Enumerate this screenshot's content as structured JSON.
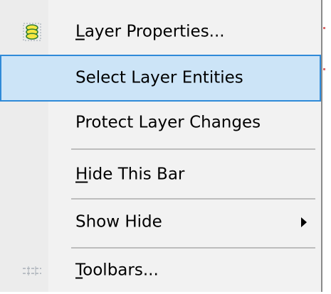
{
  "menu": {
    "items": [
      {
        "label_access": "L",
        "label_rest": "ayer Properties...",
        "icon": "layers-icon",
        "highlighted": false
      },
      {
        "label_access": "",
        "label_rest": "Select Layer Entities",
        "icon": "",
        "highlighted": true
      },
      {
        "label_access": "",
        "label_rest": "Protect Layer Changes",
        "icon": "",
        "highlighted": false
      },
      {
        "label_access": "H",
        "label_rest": "ide This Bar",
        "icon": "",
        "highlighted": false
      },
      {
        "label_access": "",
        "label_rest": "Show Hide",
        "icon": "",
        "highlighted": false,
        "has_submenu": true
      },
      {
        "label_access": "T",
        "label_rest": "oolbars...",
        "icon": "toolbars-icon",
        "highlighted": false
      }
    ]
  },
  "colors": {
    "menu_background": "#f2f2f2",
    "highlight_fill": "#cce4f7",
    "highlight_border": "#2f8ad8",
    "separator": "#bdbdbd",
    "icon_yellow": "#f5e642",
    "icon_green": "#2e7d32"
  }
}
